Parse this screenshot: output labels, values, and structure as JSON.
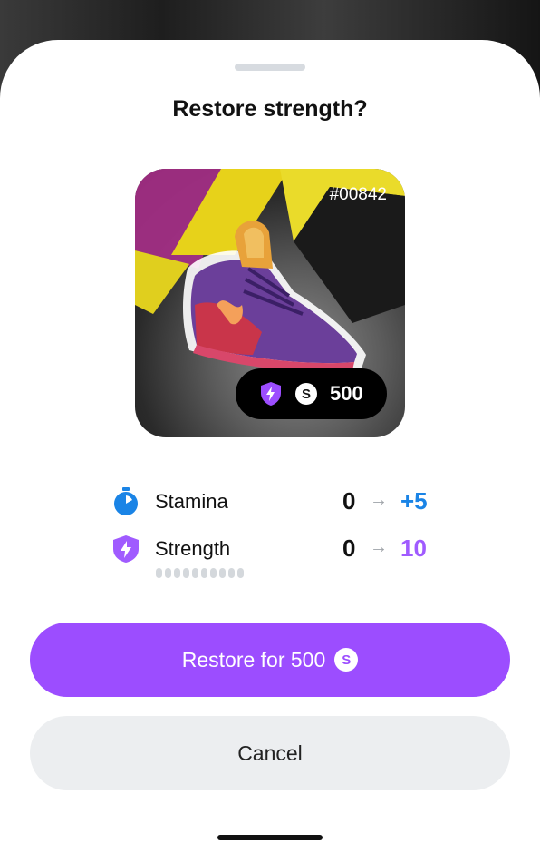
{
  "dialog": {
    "title": "Restore strength?"
  },
  "item_card": {
    "id_label": "#00842",
    "price": "500",
    "coin_symbol": "S",
    "badge_icon": "shield-bolt-icon"
  },
  "stats": [
    {
      "name": "Stamina",
      "from": "0",
      "arrow": "→",
      "to": "+5",
      "icon": "stopwatch-icon",
      "color": "#1a84e6"
    },
    {
      "name": "Strength",
      "from": "0",
      "arrow": "→",
      "to": "10",
      "icon": "shield-bolt-icon",
      "color": "#a05bff"
    }
  ],
  "strength_level": 0,
  "strength_segments": 10,
  "buttons": {
    "restore_label": "Restore for 500",
    "restore_coin_symbol": "S",
    "cancel_label": "Cancel"
  },
  "colors": {
    "primary": "#9c4dff",
    "stamina": "#1a84e6",
    "strength": "#a05bff"
  }
}
